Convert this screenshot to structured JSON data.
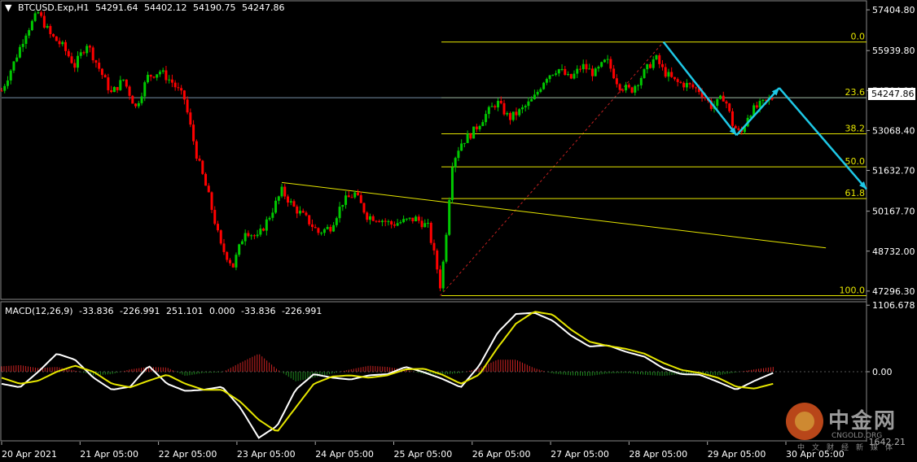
{
  "header": {
    "symbol": "BTCUSD.Exp,H1",
    "ohlc": [
      "54291.64",
      "54402.12",
      "54190.75",
      "54247.86"
    ]
  },
  "macd_header": {
    "label": "MACD(12,26,9)",
    "values": [
      "-33.836",
      "-226.991",
      "251.101",
      "0.000",
      "-33.836",
      "-226.991"
    ]
  },
  "current_price": "54247.86",
  "colors": {
    "background": "#000000",
    "bull": "#00c800",
    "bear": "#ff0000",
    "fib": "#e6e600",
    "trend": "#e6e600",
    "arrow": "#1ec8e6",
    "macd_line": "#ffffff",
    "signal_line": "#e6e600",
    "hist_pos": "#cc2222",
    "hist_neg": "#1f8a1f",
    "grid": "#777777"
  },
  "watermark": {
    "title": "中金网",
    "url": "CNGOLD.ORG",
    "sub": "中文财经新媒体",
    "overlay": "1642.21"
  },
  "chart_data": [
    {
      "type": "candlestick",
      "title": "BTCUSD.Exp,H1",
      "price_ticks": [
        "57404.80",
        "55939.80",
        "54504.10",
        "53068.40",
        "51632.70",
        "50167.70",
        "48732.00",
        "47296.30"
      ],
      "x_ticks": [
        "20 Apr 2021",
        "21 Apr 05:00",
        "22 Apr 05:00",
        "23 Apr 05:00",
        "24 Apr 05:00",
        "25 Apr 05:00",
        "26 Apr 05:00",
        "27 Apr 05:00",
        "28 Apr 05:00",
        "29 Apr 05:00",
        "30 Apr 05:00"
      ],
      "ylim": [
        47000,
        57700
      ],
      "price_path": [
        [
          0,
          54500
        ],
        [
          6,
          55500
        ],
        [
          12,
          56600
        ],
        [
          18,
          57300
        ],
        [
          24,
          56500
        ],
        [
          30,
          56100
        ],
        [
          36,
          55400
        ],
        [
          42,
          56200
        ],
        [
          48,
          55300
        ],
        [
          54,
          54400
        ],
        [
          60,
          54900
        ],
        [
          66,
          53900
        ],
        [
          72,
          55000
        ],
        [
          78,
          55200
        ],
        [
          84,
          54800
        ],
        [
          90,
          54200
        ],
        [
          96,
          52200
        ],
        [
          102,
          50700
        ],
        [
          108,
          48900
        ],
        [
          114,
          48200
        ],
        [
          120,
          49500
        ],
        [
          126,
          49200
        ],
        [
          132,
          50000
        ],
        [
          138,
          50900
        ],
        [
          144,
          50300
        ],
        [
          150,
          49900
        ],
        [
          156,
          49400
        ],
        [
          162,
          49600
        ],
        [
          168,
          50500
        ],
        [
          174,
          50800
        ],
        [
          180,
          50000
        ],
        [
          186,
          49900
        ],
        [
          192,
          49700
        ],
        [
          198,
          49800
        ],
        [
          204,
          49900
        ],
        [
          210,
          49600
        ],
        [
          214,
          48300
        ],
        [
          216,
          47500
        ],
        [
          218,
          48600
        ],
        [
          220,
          50300
        ],
        [
          222,
          51900
        ],
        [
          226,
          52600
        ],
        [
          232,
          53000
        ],
        [
          238,
          53600
        ],
        [
          244,
          54100
        ],
        [
          250,
          53500
        ],
        [
          256,
          53800
        ],
        [
          262,
          54200
        ],
        [
          268,
          55000
        ],
        [
          274,
          55300
        ],
        [
          280,
          54900
        ],
        [
          286,
          55400
        ],
        [
          292,
          55100
        ],
        [
          298,
          55600
        ],
        [
          304,
          54700
        ],
        [
          310,
          54500
        ],
        [
          316,
          55100
        ],
        [
          322,
          55700
        ],
        [
          326,
          55200
        ],
        [
          332,
          54800
        ],
        [
          338,
          54700
        ],
        [
          344,
          54500
        ],
        [
          350,
          53900
        ],
        [
          356,
          54300
        ],
        [
          360,
          53300
        ],
        [
          364,
          52900
        ],
        [
          368,
          53700
        ],
        [
          374,
          54000
        ],
        [
          380,
          54248
        ]
      ],
      "fib_levels": [
        {
          "label": "0.0",
          "price": 56250
        },
        {
          "label": "23.6",
          "price": 54248
        },
        {
          "label": "38.2",
          "price": 52950
        },
        {
          "label": "50.0",
          "price": 51760
        },
        {
          "label": "61.8",
          "price": 50620
        },
        {
          "label": "100.0",
          "price": 47130
        }
      ],
      "trendline": {
        "from": [
          138,
          51200
        ],
        "to": [
          406,
          48850
        ]
      },
      "fib_anchor": {
        "from": [
          216,
          47130
        ],
        "to": [
          326,
          56250
        ]
      },
      "arrows": [
        {
          "points": [
            [
              326,
              56250
            ],
            [
              362,
              52900
            ],
            [
              383,
              54600
            ],
            [
              426,
              50960
            ]
          ]
        }
      ]
    },
    {
      "type": "line",
      "title": "MACD(12,26,9)",
      "ylim": [
        -1150,
        1150
      ],
      "y_ticks": [
        "1106.678",
        "0.00",
        "-1642.21"
      ],
      "series": [
        {
          "name": "MACD",
          "values": [
            -200,
            -260,
            0,
            300,
            200,
            -100,
            -300,
            -250,
            100,
            -200,
            -320,
            -300,
            -250,
            -600,
            -1100,
            -900,
            -300,
            -40,
            -100,
            -130,
            -60,
            -40,
            80,
            -10,
            -120,
            -260,
            100,
            650,
            960,
            980,
            850,
            600,
            420,
            440,
            330,
            250,
            60,
            -40,
            -50,
            -170,
            -300,
            -150,
            -20
          ]
        },
        {
          "name": "Signal",
          "values": [
            -100,
            -200,
            -150,
            0,
            100,
            0,
            -200,
            -260,
            -150,
            -50,
            -200,
            -300,
            -300,
            -500,
            -800,
            -1000,
            -600,
            -200,
            -80,
            -60,
            -100,
            -60,
            40,
            50,
            -50,
            -200,
            -50,
            400,
            800,
            1000,
            950,
            700,
            500,
            430,
            380,
            300,
            150,
            30,
            -20,
            -100,
            -250,
            -280,
            -200
          ]
        },
        {
          "name": "Histogram",
          "values": [
            90,
            110,
            60,
            80,
            20,
            -60,
            -40,
            40,
            80,
            70,
            -70,
            -20,
            -10,
            150,
            300,
            40,
            -160,
            -100,
            -30,
            40,
            100,
            80,
            30,
            -40,
            -50,
            -20,
            60,
            200,
            200,
            60,
            -30,
            -60,
            -70,
            -30,
            -20,
            -50,
            -70,
            -40,
            -30,
            -60,
            -10,
            40,
            80
          ]
        }
      ]
    }
  ]
}
